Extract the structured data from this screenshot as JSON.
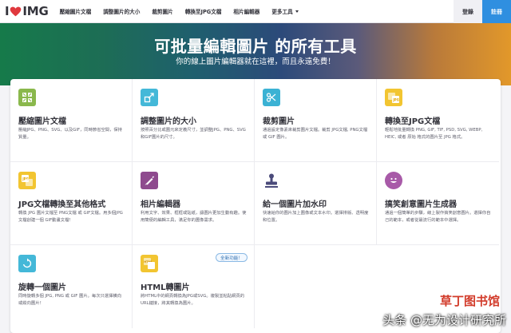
{
  "header": {
    "logo_left": "I",
    "logo_right": "IMG",
    "menu": [
      "壓縮圖片文檔",
      "調整圖片的大小",
      "裁剪圖片",
      "轉換至JPG文檔",
      "相片編輯器",
      "更多工具"
    ],
    "login": "登錄",
    "signup": "註冊"
  },
  "hero": {
    "title": "可批量編輯圖片 的所有工具",
    "subtitle": "你的線上圖片編輯器就在這裡，而且永遠免費！"
  },
  "tools": [
    {
      "title": "壓縮圖片文檔",
      "desc": "壓縮JPG、PNG、SVG、以及GIF，同時節省空間，保持質量。",
      "icon": "compress-icon",
      "color": "#8ab84c"
    },
    {
      "title": "調整圖片的大小",
      "desc": "按照百分比或圖元來定義尺寸，並調整JPG、PNG、SVG和GIF圖片的尺寸。",
      "icon": "resize-icon",
      "color": "#44b8d8"
    },
    {
      "title": "裁剪圖片",
      "desc": "通過設定像素來裁剪圖片文檔。裁剪 JPG文檔, PNG文檔 或 GIF 圖片。",
      "icon": "scissors-icon",
      "color": "#3bb2d4"
    },
    {
      "title": "轉換至JPG文檔",
      "desc": "輕鬆地批量轉換 PNG, GIF, TIF, PSD, SVG, WEBP, HEIC, 或者 原始 格式的圖片至 JPG 格式。",
      "icon": "to-jpg-icon",
      "color": "#f2c531"
    },
    {
      "title": "JPG文檔轉換至其他格式",
      "desc": "轉換 JPG 圖片文檔至 PNG文檔 或 GIF文檔。用多個JPG文檔創建一個 GIF動畫文檔！",
      "icon": "from-jpg-icon",
      "color": "#f2c531"
    },
    {
      "title": "相片編輯器",
      "desc": "利用文字、效果、框框或貼紙，讓圖片更加生動有趣。使用簡便的編輯工具，滿足你的圖像需求。",
      "icon": "brush-icon",
      "color": "#8e4a8e"
    },
    {
      "title": "給一個圖片加水印",
      "desc": "快速給你的圖片加上圖像或文本水印。選擇排版、透明度和位置。",
      "icon": "stamp-icon",
      "color": "#4a4a7a"
    },
    {
      "title": "搞笑創意圖片生成器",
      "desc": "通過一個簡單的步驟，線上製作搞笑創意圖片。選擇你自己的範本，或者從最流行的範本中選擇。",
      "icon": "meme-icon",
      "color": "#a85aa8"
    },
    {
      "title": "旋轉一個圖片",
      "desc": "同時旋轉多個 JPG, PNG 或 GIF 圖片。每次只選擇橫向或縱向圖片！",
      "icon": "rotate-icon",
      "color": "#44b8d8"
    },
    {
      "title": "HTML轉圖片",
      "desc": "將HTML中的網頁轉換為JPG或SVG。複製並粘貼網頁的URL鏈接，將其轉換為圖片。",
      "icon": "html-icon",
      "color": "#f2c531",
      "badge": "全新功能！"
    }
  ],
  "watermark": {
    "brand": "草丁图书馆",
    "text": "头条 @无为设计研究所"
  }
}
